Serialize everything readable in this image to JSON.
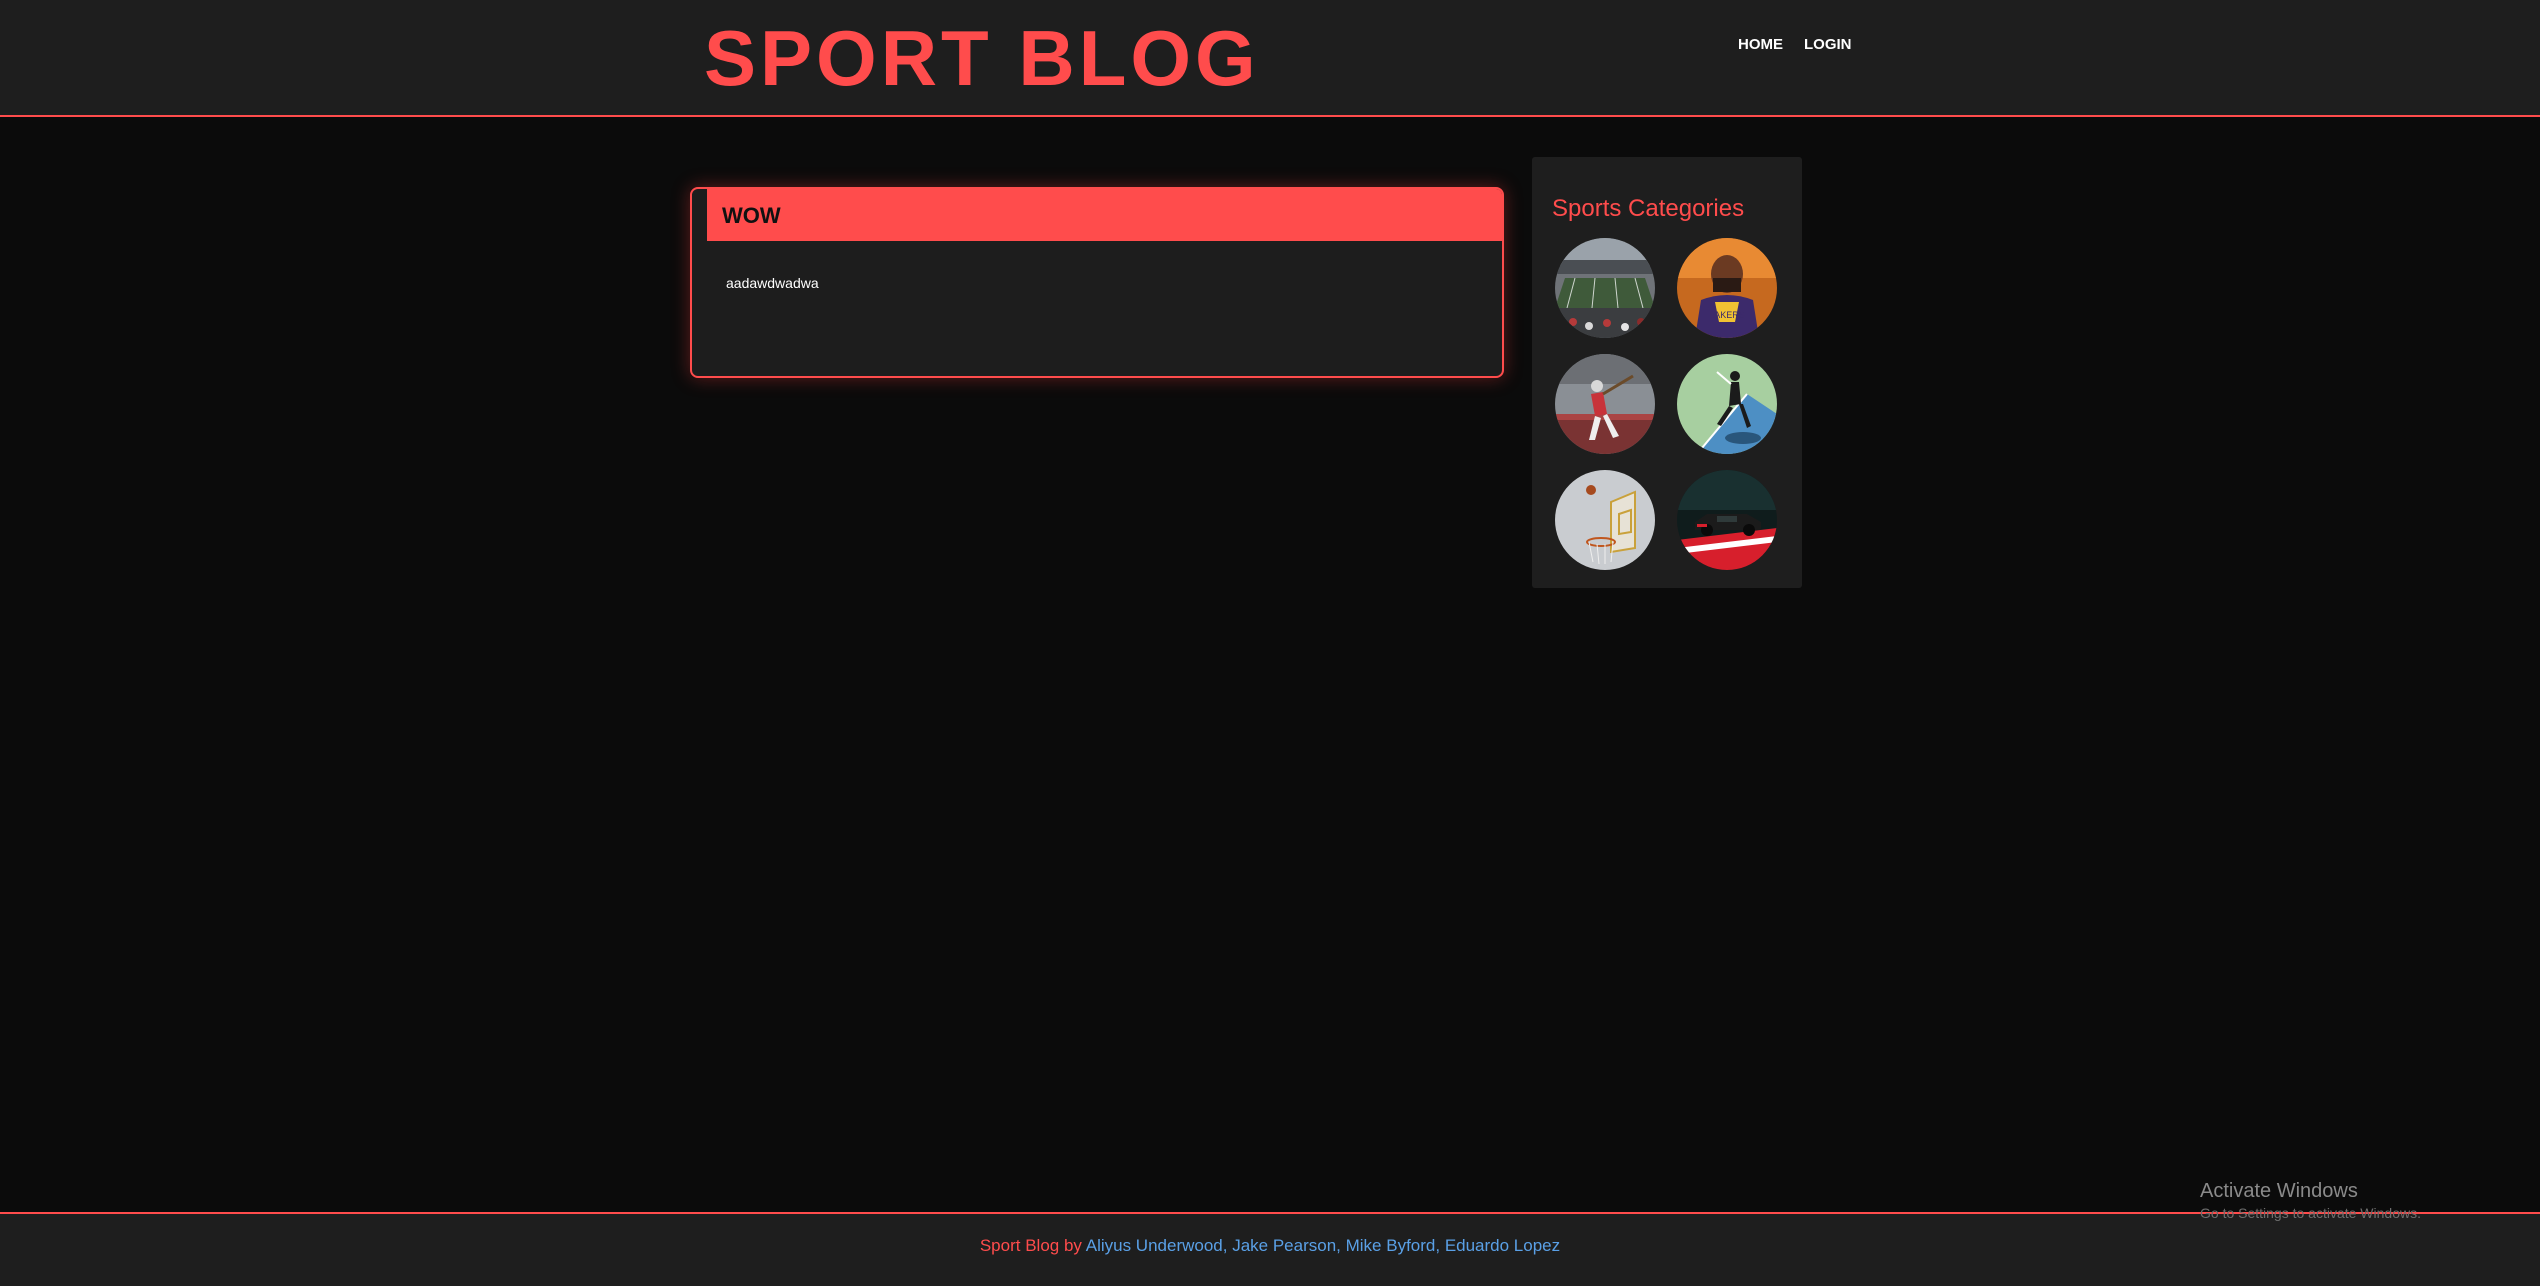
{
  "header": {
    "logo": "SPORT BLOG",
    "nav": [
      {
        "label": "HOME"
      },
      {
        "label": "LOGIN"
      }
    ]
  },
  "post": {
    "title": "WOW",
    "body": "aadawdwadwa"
  },
  "sidebar": {
    "title": "Sports Categories",
    "categories": [
      {
        "icon": "football-stadium-image"
      },
      {
        "icon": "basketball-player-image"
      },
      {
        "icon": "baseball-batter-image"
      },
      {
        "icon": "tennis-player-image"
      },
      {
        "icon": "basketball-hoop-image"
      },
      {
        "icon": "race-car-image"
      }
    ]
  },
  "footer": {
    "brand": "Sport Blog",
    "by": "by",
    "authors": [
      "Aliyus Underwood",
      "Jake Pearson",
      "Mike Byford",
      "Eduardo Lopez"
    ]
  },
  "watermark": {
    "title": "Activate Windows",
    "subtitle": "Go to Settings to activate Windows."
  },
  "colors": {
    "accent": "#ff4c4c",
    "background": "#0b0b0b",
    "panel": "#1e1e1e",
    "link": "#5aa0e6"
  }
}
